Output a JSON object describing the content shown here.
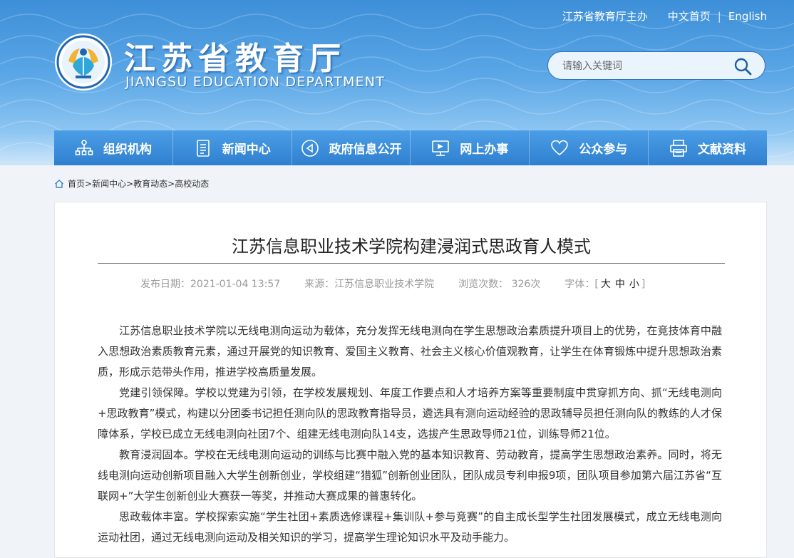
{
  "header": {
    "sponsor": "江苏省教育厅主办",
    "lang_cn": "中文首页",
    "lang_en": "English",
    "logo_cn": "江苏省教育厅",
    "logo_en": "JIANGSU EDUCATION DEPARTMENT",
    "search_placeholder": "请输入关键词",
    "search_icon": "search-icon"
  },
  "nav": {
    "items": [
      {
        "label": "组织机构",
        "icon": "org-chart-icon"
      },
      {
        "label": "新闻中心",
        "icon": "document-icon"
      },
      {
        "label": "政府信息公开",
        "icon": "megaphone-icon"
      },
      {
        "label": "网上办事",
        "icon": "monitor-icon"
      },
      {
        "label": "公众参与",
        "icon": "heart-icon"
      },
      {
        "label": "文献资料",
        "icon": "printer-icon"
      }
    ]
  },
  "breadcrumb": {
    "items": [
      "首页>",
      "新闻中心>",
      "教育动态>",
      "高校动态"
    ]
  },
  "article": {
    "title": "江苏信息职业技术学院构建浸润式思政育人模式",
    "meta": {
      "date": "发布日期：2021-01-04 13:57",
      "source": "来源：江苏信息职业技术学院",
      "views": "浏览次数：  326次",
      "font_label": "字体：[",
      "font_large": "大",
      "font_medium": "中",
      "font_small": "小",
      "font_close": "]"
    },
    "paragraphs": [
      "江苏信息职业技术学院以无线电测向运动为载体，充分发挥无线电测向在学生思想政治素质提升项目上的优势，在竞技体育中融入思想政治素质教育元素，通过开展党的知识教育、爱国主义教育、社会主义核心价值观教育，让学生在体育锻炼中提升思想政治素质，形成示范带头作用，推进学校高质量发展。",
      "党建引领保障。学校以党建为引领，在学校发展规划、年度工作要点和人才培养方案等重要制度中贯穿抓方向、抓“无线电测向+思政教育”模式，构建以分团委书记担任测向队的思政教育指导员，遴选具有测向运动经验的思政辅导员担任测向队的教练的人才保障体系，学校已成立无线电测向社团7个、组建无线电测向队14支，选拔产生思政导师21位，训练导师21位。",
      "教育浸润固本。学校在无线电测向运动的训练与比赛中融入党的基本知识教育、劳动教育，提高学生思想政治素养。同时，将无线电测向运动创新项目融入大学生创新创业，学校组建“猎狐”创新创业团队，团队成员专利申报9项，团队项目参加第六届江苏省“互联网+”大学生创新创业大赛获一等奖，并推动大赛成果的普惠转化。",
      "思政载体丰富。学校探索实施“学生社团+素质选修课程+集训队+参与竞赛”的自主成长型学生社团发展模式，成立无线电测向运动社团，通过无线电测向运动及相关知识的学习，提高学生理论知识水平及动手能力。"
    ]
  }
}
